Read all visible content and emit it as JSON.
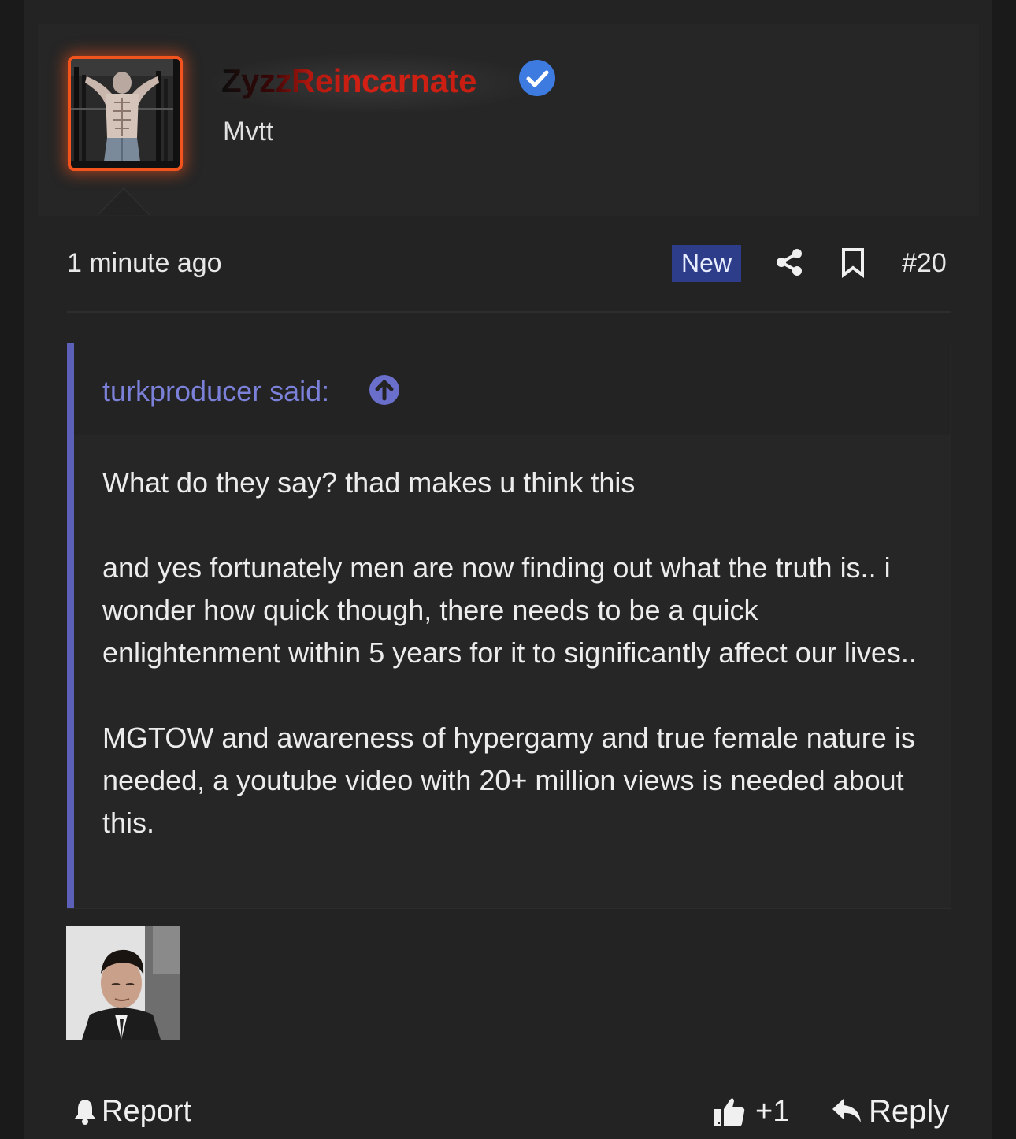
{
  "post": {
    "author": {
      "username": "ZyzzReincarnate",
      "title": "Mvtt",
      "verified": true,
      "avatar_icon": "bodybuilder-avatar",
      "avatar_border_color": "#f3541e"
    },
    "meta": {
      "timestamp": "1 minute ago",
      "badge": "New",
      "post_number": "#20"
    },
    "quote": {
      "attribution": "turkproducer said:",
      "paragraphs": [
        "What do they say? thad makes u think this",
        "and yes fortunately men are now finding out what the truth is.. i wonder how quick though, there needs to be a quick enlightenment within 5 years for it to significantly affect our lives..",
        "MGTOW and awareness of hypergamy and true female nature is needed, a youtube video with 20+ million views is needed about this."
      ],
      "accent_color": "#5c60b8"
    },
    "attachment": {
      "icon": "reaction-image-man-in-suit"
    },
    "actions": {
      "report_label": "Report",
      "like_count": "+1",
      "reply_label": "Reply"
    }
  },
  "colors": {
    "background": "#1a1a1a",
    "panel": "#232323",
    "badge": "#2d3d8a",
    "link": "#7b80d8",
    "verified": "#3d7be0"
  }
}
